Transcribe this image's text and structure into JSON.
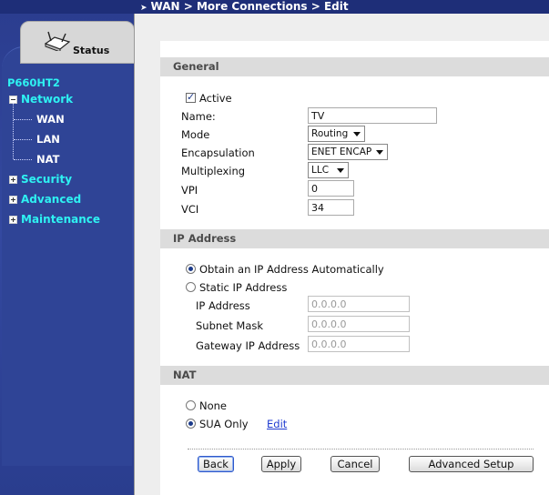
{
  "breadcrumb": "WAN > More Connections > Edit",
  "nav": {
    "status_tab": "Status",
    "device": "P660HT2",
    "network": "Network",
    "network_children": [
      "WAN",
      "LAN",
      "NAT"
    ],
    "security": "Security",
    "advanced": "Advanced",
    "maintenance": "Maintenance"
  },
  "general": {
    "title": "General",
    "active_label": "Active",
    "active_checked": true,
    "name_label": "Name:",
    "name_value": "TV",
    "mode_label": "Mode",
    "mode_value": "Routing",
    "encap_label": "Encapsulation",
    "encap_value": "ENET ENCAP",
    "mux_label": "Multiplexing",
    "mux_value": "LLC",
    "vpi_label": "VPI",
    "vpi_value": "0",
    "vci_label": "VCI",
    "vci_value": "34"
  },
  "ip": {
    "title": "IP Address",
    "auto_label": "Obtain an IP Address Automatically",
    "static_label": "Static IP Address",
    "ip_label": "IP Address",
    "ip_value": "0.0.0.0",
    "mask_label": "Subnet Mask",
    "mask_value": "0.0.0.0",
    "gw_label": "Gateway IP Address",
    "gw_value": "0.0.0.0",
    "selected": "auto"
  },
  "nat": {
    "title": "NAT",
    "none_label": "None",
    "sua_label": "SUA Only",
    "edit_link": "Edit",
    "selected": "sua"
  },
  "buttons": {
    "back": "Back",
    "apply": "Apply",
    "cancel": "Cancel",
    "advanced": "Advanced Setup"
  },
  "colors": {
    "nav_bg": "#2a3f8e",
    "nav_text": "#2ef2f2",
    "link": "#1f3bd0"
  }
}
